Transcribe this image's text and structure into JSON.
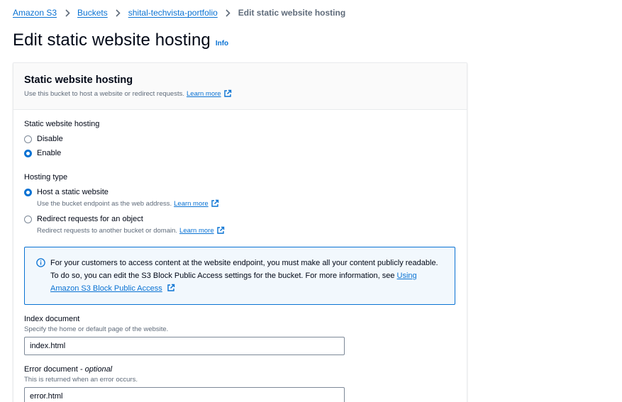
{
  "breadcrumb": {
    "items": [
      "Amazon S3",
      "Buckets",
      "shital-techvista-portfolio"
    ],
    "current": "Edit static website hosting"
  },
  "header": {
    "title": "Edit static website hosting",
    "info": "Info"
  },
  "panel": {
    "title": "Static website hosting",
    "description": "Use this bucket to host a website or redirect requests.",
    "learn_more": "Learn more",
    "hosting": {
      "label": "Static website hosting",
      "options": [
        "Disable",
        "Enable"
      ],
      "selected": "Enable"
    },
    "hosting_type": {
      "label": "Hosting type",
      "options": [
        {
          "label": "Host a static website",
          "description": "Use the bucket endpoint as the web address.",
          "link": "Learn more"
        },
        {
          "label": "Redirect requests for an object",
          "description": "Redirect requests to another bucket or domain.",
          "link": "Learn more"
        }
      ],
      "selected": "Host a static website"
    },
    "alert": {
      "text": "For your customers to access content at the website endpoint, you must make all your content publicly readable. To do so, you can edit the S3 Block Public Access settings for the bucket. For more information, see",
      "link": "Using Amazon S3 Block Public Access"
    },
    "index_document": {
      "label": "Index document",
      "description": "Specify the home or default page of the website.",
      "value": "index.html"
    },
    "error_document": {
      "label": "Error document",
      "optional": "- optional",
      "description": "This is returned when an error occurs.",
      "value": "error.html"
    }
  },
  "colors": {
    "link": "#0972d3",
    "alert_bg": "#f2f8fd",
    "muted_text": "#5f6b7a"
  },
  "icons": [
    "chevron-right-icon",
    "external-link-icon",
    "info-circle-icon"
  ]
}
